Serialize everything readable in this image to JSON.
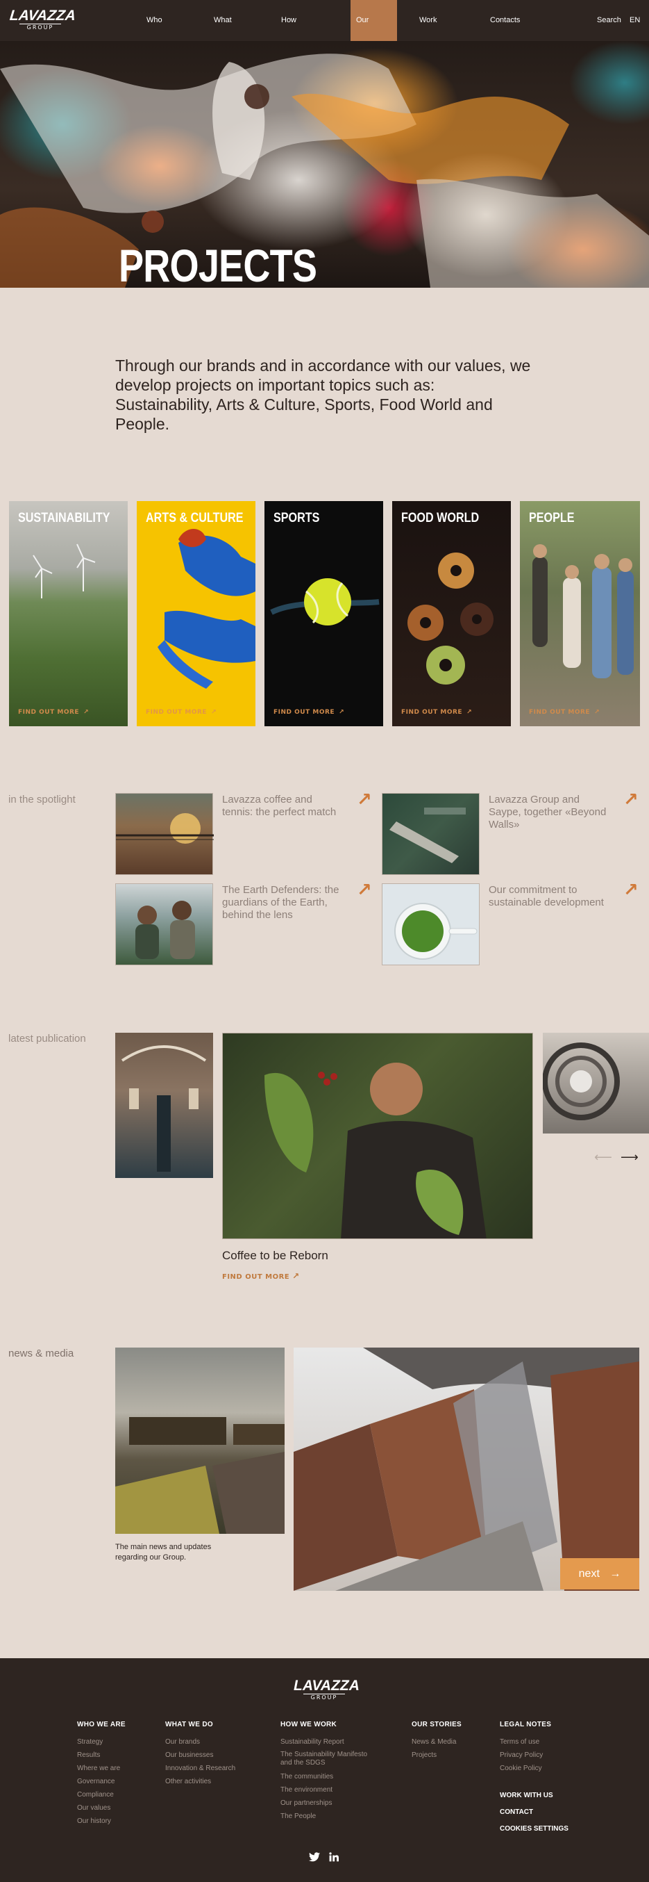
{
  "header": {
    "logo_word": "LAVAZZA",
    "logo_sub": "GROUP",
    "nav": [
      "Who we are",
      "What we do",
      "How we work",
      "Our stories",
      "Work with us",
      "Contacts"
    ],
    "active_nav": "Our stories",
    "search": "Search",
    "lang": "EN",
    "accent": "#b7784b"
  },
  "hero": {
    "title": "PROJECTS"
  },
  "intro": "Through our brands and in accordance with our values, we develop projects on important topics such as: Sustainability, Arts & Culture, Sports, Food World and People.",
  "categories": [
    {
      "title": "SUSTAINABILITY",
      "link": "FIND OUT MORE"
    },
    {
      "title": "ARTS & CULTURE",
      "link": "FIND OUT MORE"
    },
    {
      "title": "SPORTS",
      "link": "FIND OUT MORE"
    },
    {
      "title": "FOOD WORLD",
      "link": "FIND OUT MORE"
    },
    {
      "title": "PEOPLE",
      "link": "FIND OUT MORE"
    }
  ],
  "spotlight": {
    "label": "in the spotlight",
    "items": [
      {
        "text": "Lavazza coffee and tennis: the perfect match"
      },
      {
        "text": "Lavazza Group and Saype, together «Beyond Walls»"
      },
      {
        "text": "The Earth Defenders: the guardians of the Earth, behind the lens"
      },
      {
        "text": "Our commitment to sustainable development"
      }
    ]
  },
  "publication": {
    "label": "latest publication",
    "title": "Coffee to be Reborn",
    "link": "FIND OUT MORE"
  },
  "news": {
    "label": "news & media",
    "caption": "The main news and updates regarding our Group.",
    "next": "next"
  },
  "footer": {
    "logo_word": "LAVAZZA",
    "logo_sub": "GROUP",
    "columns": [
      {
        "heading": "WHO WE ARE",
        "links": [
          "Strategy",
          "Results",
          "Where we are",
          "Governance",
          "Compliance",
          "Our values",
          "Our history"
        ]
      },
      {
        "heading": "WHAT WE DO",
        "links": [
          "Our brands",
          "Our businesses",
          "Innovation & Research",
          "Other activities"
        ]
      },
      {
        "heading": "HOW WE WORK",
        "links": [
          "Sustainability Report",
          "The Sustainability Manifesto and the SDGS",
          "The communities",
          "The environment",
          "Our partnerships",
          "The People"
        ]
      },
      {
        "heading": "OUR STORIES",
        "links": [
          "News & Media",
          "Projects"
        ]
      },
      {
        "heading": "LEGAL NOTES",
        "links": [
          "Terms of use",
          "Privacy Policy",
          "Cookie Policy"
        ]
      }
    ],
    "extra": [
      "WORK WITH US",
      "CONTACT",
      "COOKIES SETTINGS"
    ],
    "social": [
      "twitter-icon",
      "linkedin-icon"
    ]
  }
}
